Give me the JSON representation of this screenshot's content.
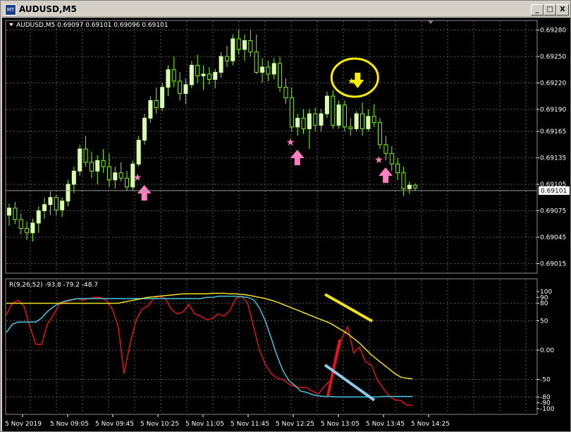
{
  "window": {
    "title": "AUDUSD,M5",
    "icon": "chart-window-icon",
    "buttons": {
      "minimize": "_",
      "restore": "□",
      "close": "X"
    }
  },
  "price_panel": {
    "header": "AUDUSD,M5  0.69097 0.69101 0.69096 0.69101",
    "current_price": "0.69101",
    "axis_labels": [
      "0.69280",
      "0.69250",
      "0.69220",
      "0.69190",
      "0.69165",
      "0.69135",
      "0.69105",
      "0.69075",
      "0.69045",
      "0.69015"
    ]
  },
  "indicator_panel": {
    "header": "R(9,26,52) -93.8 -79.2 -48.7",
    "axis_labels": [
      "100",
      "90",
      "80",
      "50",
      "0.00",
      "-50",
      "-80",
      "-90",
      "-100"
    ]
  },
  "time_axis": [
    "5 Nov 2019",
    "5 Nov 09:05",
    "5 Nov 09:45",
    "5 Nov 10:25",
    "5 Nov 11:05",
    "5 Nov 11:45",
    "5 Nov 12:25",
    "5 Nov 13:05",
    "5 Nov 13:45",
    "5 Nov 14:25"
  ],
  "colors": {
    "background": "#000000",
    "grid": "#5a5a5a",
    "bull_candle": "#d8ffb0",
    "wick": "#7cfc00",
    "up_arrow": "#ff80c0",
    "down_arrow": "#ffee00",
    "circle": "#ffee00",
    "line_red": "#e0141c",
    "line_cyan": "#40c8e0",
    "line_yellow": "#f0e020"
  },
  "chart_data": {
    "type": "candlestick",
    "symbol": "AUDUSD",
    "timeframe": "M5",
    "ylim": [
      0.69005,
      0.6929
    ],
    "ohlc": [
      [
        0.6907,
        0.69083,
        0.69058,
        0.69078
      ],
      [
        0.69078,
        0.69085,
        0.6906,
        0.69065
      ],
      [
        0.69065,
        0.69072,
        0.69048,
        0.69055
      ],
      [
        0.69055,
        0.69063,
        0.69042,
        0.6905
      ],
      [
        0.6905,
        0.69066,
        0.6904,
        0.69061
      ],
      [
        0.69061,
        0.6908,
        0.6905,
        0.69075
      ],
      [
        0.69075,
        0.6909,
        0.69066,
        0.69082
      ],
      [
        0.69082,
        0.69097,
        0.6907,
        0.6909
      ],
      [
        0.6909,
        0.69093,
        0.6907,
        0.69076
      ],
      [
        0.69076,
        0.6909,
        0.69068,
        0.69086
      ],
      [
        0.69086,
        0.6911,
        0.6908,
        0.69105
      ],
      [
        0.69105,
        0.69125,
        0.69095,
        0.6912
      ],
      [
        0.6912,
        0.6915,
        0.69115,
        0.69145
      ],
      [
        0.69145,
        0.6916,
        0.69125,
        0.6913
      ],
      [
        0.6913,
        0.69142,
        0.69112,
        0.6912
      ],
      [
        0.6912,
        0.69138,
        0.69105,
        0.69132
      ],
      [
        0.69132,
        0.69145,
        0.69118,
        0.69125
      ],
      [
        0.69125,
        0.6914,
        0.69102,
        0.6911
      ],
      [
        0.6911,
        0.69125,
        0.691,
        0.69118
      ],
      [
        0.69118,
        0.6913,
        0.69108,
        0.69112
      ],
      [
        0.69112,
        0.6912,
        0.69098,
        0.69102
      ],
      [
        0.69102,
        0.69132,
        0.69098,
        0.69128
      ],
      [
        0.69128,
        0.6916,
        0.69125,
        0.69155
      ],
      [
        0.69155,
        0.69185,
        0.6915,
        0.6918
      ],
      [
        0.6918,
        0.69205,
        0.69175,
        0.692
      ],
      [
        0.692,
        0.69215,
        0.69185,
        0.69192
      ],
      [
        0.69192,
        0.6922,
        0.69188,
        0.69215
      ],
      [
        0.69215,
        0.6924,
        0.69205,
        0.69235
      ],
      [
        0.69235,
        0.6925,
        0.69215,
        0.69222
      ],
      [
        0.69222,
        0.69232,
        0.692,
        0.69208
      ],
      [
        0.69208,
        0.69225,
        0.69196,
        0.69218
      ],
      [
        0.69218,
        0.69245,
        0.69214,
        0.6924
      ],
      [
        0.6924,
        0.69252,
        0.6922,
        0.69228
      ],
      [
        0.69228,
        0.6924,
        0.69212,
        0.6923
      ],
      [
        0.6923,
        0.69238,
        0.69218,
        0.69224
      ],
      [
        0.69224,
        0.69236,
        0.69214,
        0.69232
      ],
      [
        0.69232,
        0.69255,
        0.69226,
        0.6925
      ],
      [
        0.6925,
        0.69262,
        0.69238,
        0.69245
      ],
      [
        0.69245,
        0.69275,
        0.6924,
        0.6927
      ],
      [
        0.6927,
        0.6928,
        0.69252,
        0.69258
      ],
      [
        0.69258,
        0.69275,
        0.69245,
        0.69268
      ],
      [
        0.69268,
        0.6928,
        0.6925,
        0.69255
      ],
      [
        0.69255,
        0.69275,
        0.6923,
        0.69232
      ],
      [
        0.69232,
        0.69248,
        0.6922,
        0.69238
      ],
      [
        0.69238,
        0.69245,
        0.69222,
        0.6923
      ],
      [
        0.6923,
        0.69248,
        0.69224,
        0.69242
      ],
      [
        0.69242,
        0.6925,
        0.6921,
        0.69215
      ],
      [
        0.69215,
        0.69225,
        0.69196,
        0.69203
      ],
      [
        0.69203,
        0.69215,
        0.69165,
        0.6917
      ],
      [
        0.6917,
        0.69185,
        0.6916,
        0.6918
      ],
      [
        0.6918,
        0.6919,
        0.69162,
        0.69168
      ],
      [
        0.69168,
        0.6919,
        0.69145,
        0.69185
      ],
      [
        0.69185,
        0.69192,
        0.69165,
        0.69172
      ],
      [
        0.69172,
        0.6919,
        0.69165,
        0.69185
      ],
      [
        0.69185,
        0.6921,
        0.6918,
        0.69205
      ],
      [
        0.69205,
        0.69212,
        0.69168,
        0.69172
      ],
      [
        0.69172,
        0.692,
        0.69168,
        0.69195
      ],
      [
        0.69195,
        0.692,
        0.69165,
        0.6917
      ],
      [
        0.6917,
        0.6918,
        0.6916,
        0.69168
      ],
      [
        0.69168,
        0.69188,
        0.69165,
        0.69185
      ],
      [
        0.69185,
        0.69198,
        0.6916,
        0.69168
      ],
      [
        0.69168,
        0.6919,
        0.69165,
        0.69182
      ],
      [
        0.69182,
        0.69196,
        0.6917,
        0.69175
      ],
      [
        0.69175,
        0.6918,
        0.69145,
        0.6915
      ],
      [
        0.6915,
        0.6916,
        0.69132,
        0.6914
      ],
      [
        0.6914,
        0.69148,
        0.6912,
        0.69128
      ],
      [
        0.69128,
        0.69135,
        0.6911,
        0.69118
      ],
      [
        0.69118,
        0.69125,
        0.69092,
        0.691
      ],
      [
        0.691,
        0.69108,
        0.69094,
        0.69104
      ],
      [
        0.69104,
        0.69106,
        0.69098,
        0.69101
      ]
    ],
    "up_arrow_bars": [
      22,
      48,
      63
    ],
    "down_arrow_bars": [
      58
    ],
    "oscillator": {
      "name": "R(9,26,52)",
      "values": [
        -93.8,
        -79.2,
        -48.7
      ],
      "ylim": [
        -100,
        100
      ],
      "levels": [
        100,
        90,
        80,
        50,
        0,
        -50,
        -80,
        -90,
        -100
      ],
      "series": [
        {
          "values": [
            60,
            80,
            85,
            75,
            40,
            10,
            10,
            45,
            60,
            78,
            82,
            85,
            88,
            85,
            88,
            90,
            90,
            85,
            70,
            40,
            -40,
            10,
            50,
            70,
            75,
            88,
            92,
            88,
            70,
            62,
            65,
            78,
            62,
            58,
            52,
            54,
            62,
            58,
            68,
            88,
            92,
            80,
            40,
            0,
            -25,
            -40,
            -48,
            -50,
            -58,
            -62,
            -64,
            -64,
            -70,
            -75,
            -62,
            -52,
            -20,
            20,
            40,
            -5,
            5,
            -20,
            -25,
            -50,
            -65,
            -78,
            -85,
            -86,
            -94,
            -94
          ]
        },
        {
          "values": [
            30,
            44,
            48,
            48,
            48,
            48,
            55,
            66,
            74,
            80,
            84,
            86,
            88,
            88,
            88,
            88,
            88,
            88,
            88,
            88,
            88,
            88,
            88,
            88,
            88,
            88,
            88,
            88,
            88,
            88,
            88,
            88,
            88,
            88,
            90,
            90,
            92,
            92,
            92,
            92,
            91,
            90,
            86,
            72,
            50,
            20,
            -10,
            -35,
            -52,
            -60,
            -70,
            -72,
            -76,
            -78,
            -79,
            -79,
            -80,
            -80,
            -80,
            -80,
            -80,
            -80,
            -80,
            -80,
            -79,
            -79,
            -79,
            -79,
            -79,
            -79
          ]
        },
        {
          "values": [
            80,
            80,
            80,
            80,
            80,
            80,
            80,
            80,
            80,
            80,
            80,
            80,
            80,
            80,
            80,
            80,
            80,
            80,
            80,
            80,
            82,
            84,
            86,
            88,
            90,
            91,
            92,
            93,
            94,
            95,
            96,
            96,
            96,
            96,
            96,
            97,
            97,
            97,
            96,
            96,
            95,
            94,
            92,
            90,
            88,
            85,
            82,
            78,
            74,
            70,
            66,
            62,
            58,
            54,
            50,
            46,
            40,
            34,
            28,
            20,
            12,
            2,
            -8,
            -16,
            -24,
            -32,
            -40,
            -46,
            -48,
            -49
          ]
        }
      ]
    },
    "annotations": [
      "yellow-circle-around-sell-arrow",
      "red-trendline-up",
      "lightblue-trendline-down",
      "yellow-trendline-down"
    ]
  }
}
